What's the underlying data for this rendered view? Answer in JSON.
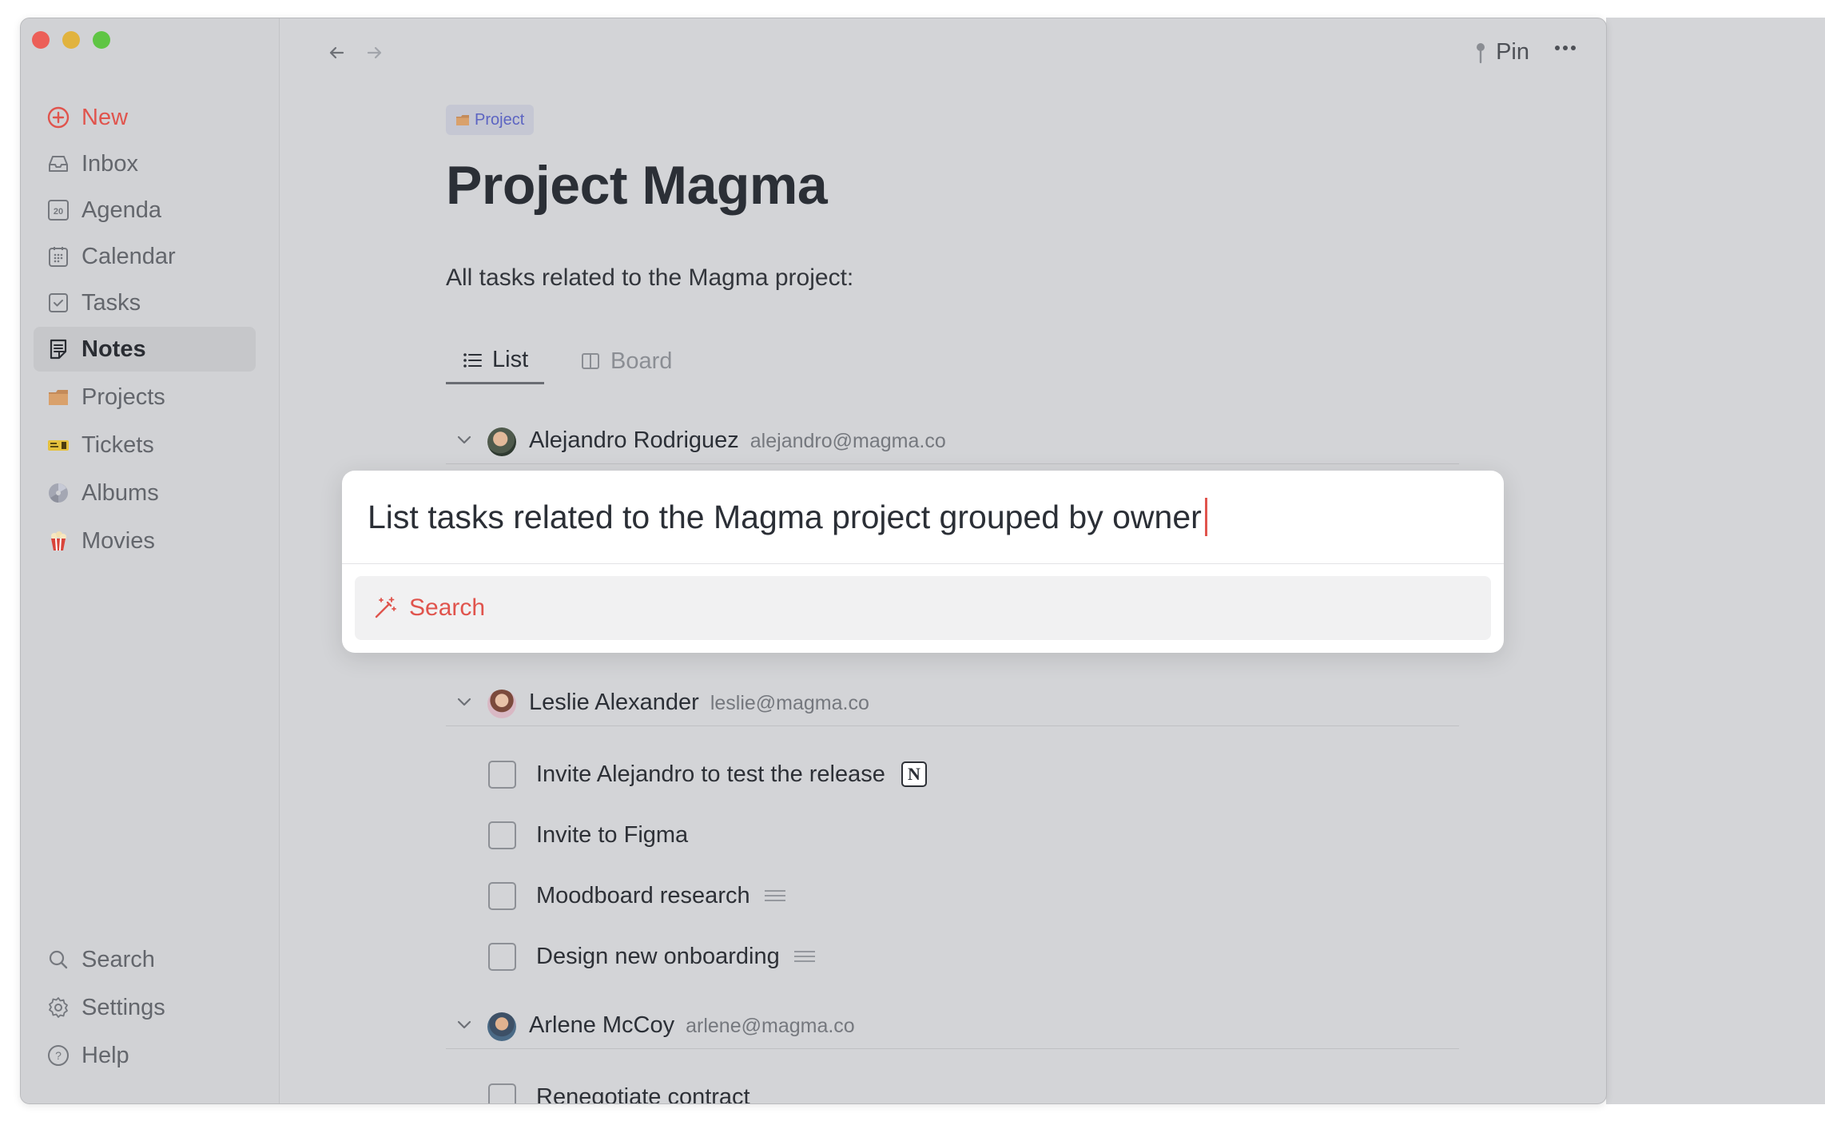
{
  "sidebar": {
    "items": [
      {
        "label": "New",
        "icon": "plus-circle-icon"
      },
      {
        "label": "Inbox",
        "icon": "inbox-icon"
      },
      {
        "label": "Agenda",
        "icon": "agenda-icon",
        "icon_text": "20"
      },
      {
        "label": "Calendar",
        "icon": "calendar-icon"
      },
      {
        "label": "Tasks",
        "icon": "checkbox-icon"
      },
      {
        "label": "Notes",
        "icon": "notes-icon"
      },
      {
        "label": "Projects",
        "icon": "folder-emoji-icon"
      },
      {
        "label": "Tickets",
        "icon": "ticket-emoji-icon"
      },
      {
        "label": "Albums",
        "icon": "disc-emoji-icon"
      },
      {
        "label": "Movies",
        "icon": "popcorn-emoji-icon"
      }
    ],
    "bottom": [
      {
        "label": "Search",
        "icon": "search-icon"
      },
      {
        "label": "Settings",
        "icon": "gear-icon"
      },
      {
        "label": "Help",
        "icon": "help-icon",
        "icon_text": "?"
      }
    ],
    "active": "Notes"
  },
  "toolbar": {
    "back_icon": "arrow-left-icon",
    "forward_icon": "arrow-right-icon",
    "pin_label": "Pin",
    "more_icon": "ellipsis-icon"
  },
  "page": {
    "badge": "Project",
    "title": "Project Magma",
    "description": "All tasks related to the Magma project:",
    "tabs": [
      {
        "label": "List",
        "selected": true
      },
      {
        "label": "Board",
        "selected": false
      }
    ]
  },
  "groups": [
    {
      "name": "Alejandro Rodriguez",
      "email": "alejandro@magma.co"
    },
    {
      "name": "Leslie Alexander",
      "email": "leslie@magma.co",
      "tasks": [
        {
          "label": "Invite Alejandro to test the release",
          "badge": "N"
        },
        {
          "label": "Invite to Figma"
        },
        {
          "label": "Moodboard research",
          "has_note": true
        },
        {
          "label": "Design new onboarding",
          "has_note": true
        }
      ]
    },
    {
      "name": "Arlene McCoy",
      "email": "arlene@magma.co",
      "tasks": [
        {
          "label": "Renegotiate contract"
        }
      ]
    }
  ],
  "palette": {
    "query": "List tasks related to the Magma project grouped by owner",
    "result_label": "Search",
    "result_icon": "magic-wand-icon"
  },
  "colors": {
    "accent_red": "#e0544d",
    "badge_blue": "#5c64c2"
  }
}
